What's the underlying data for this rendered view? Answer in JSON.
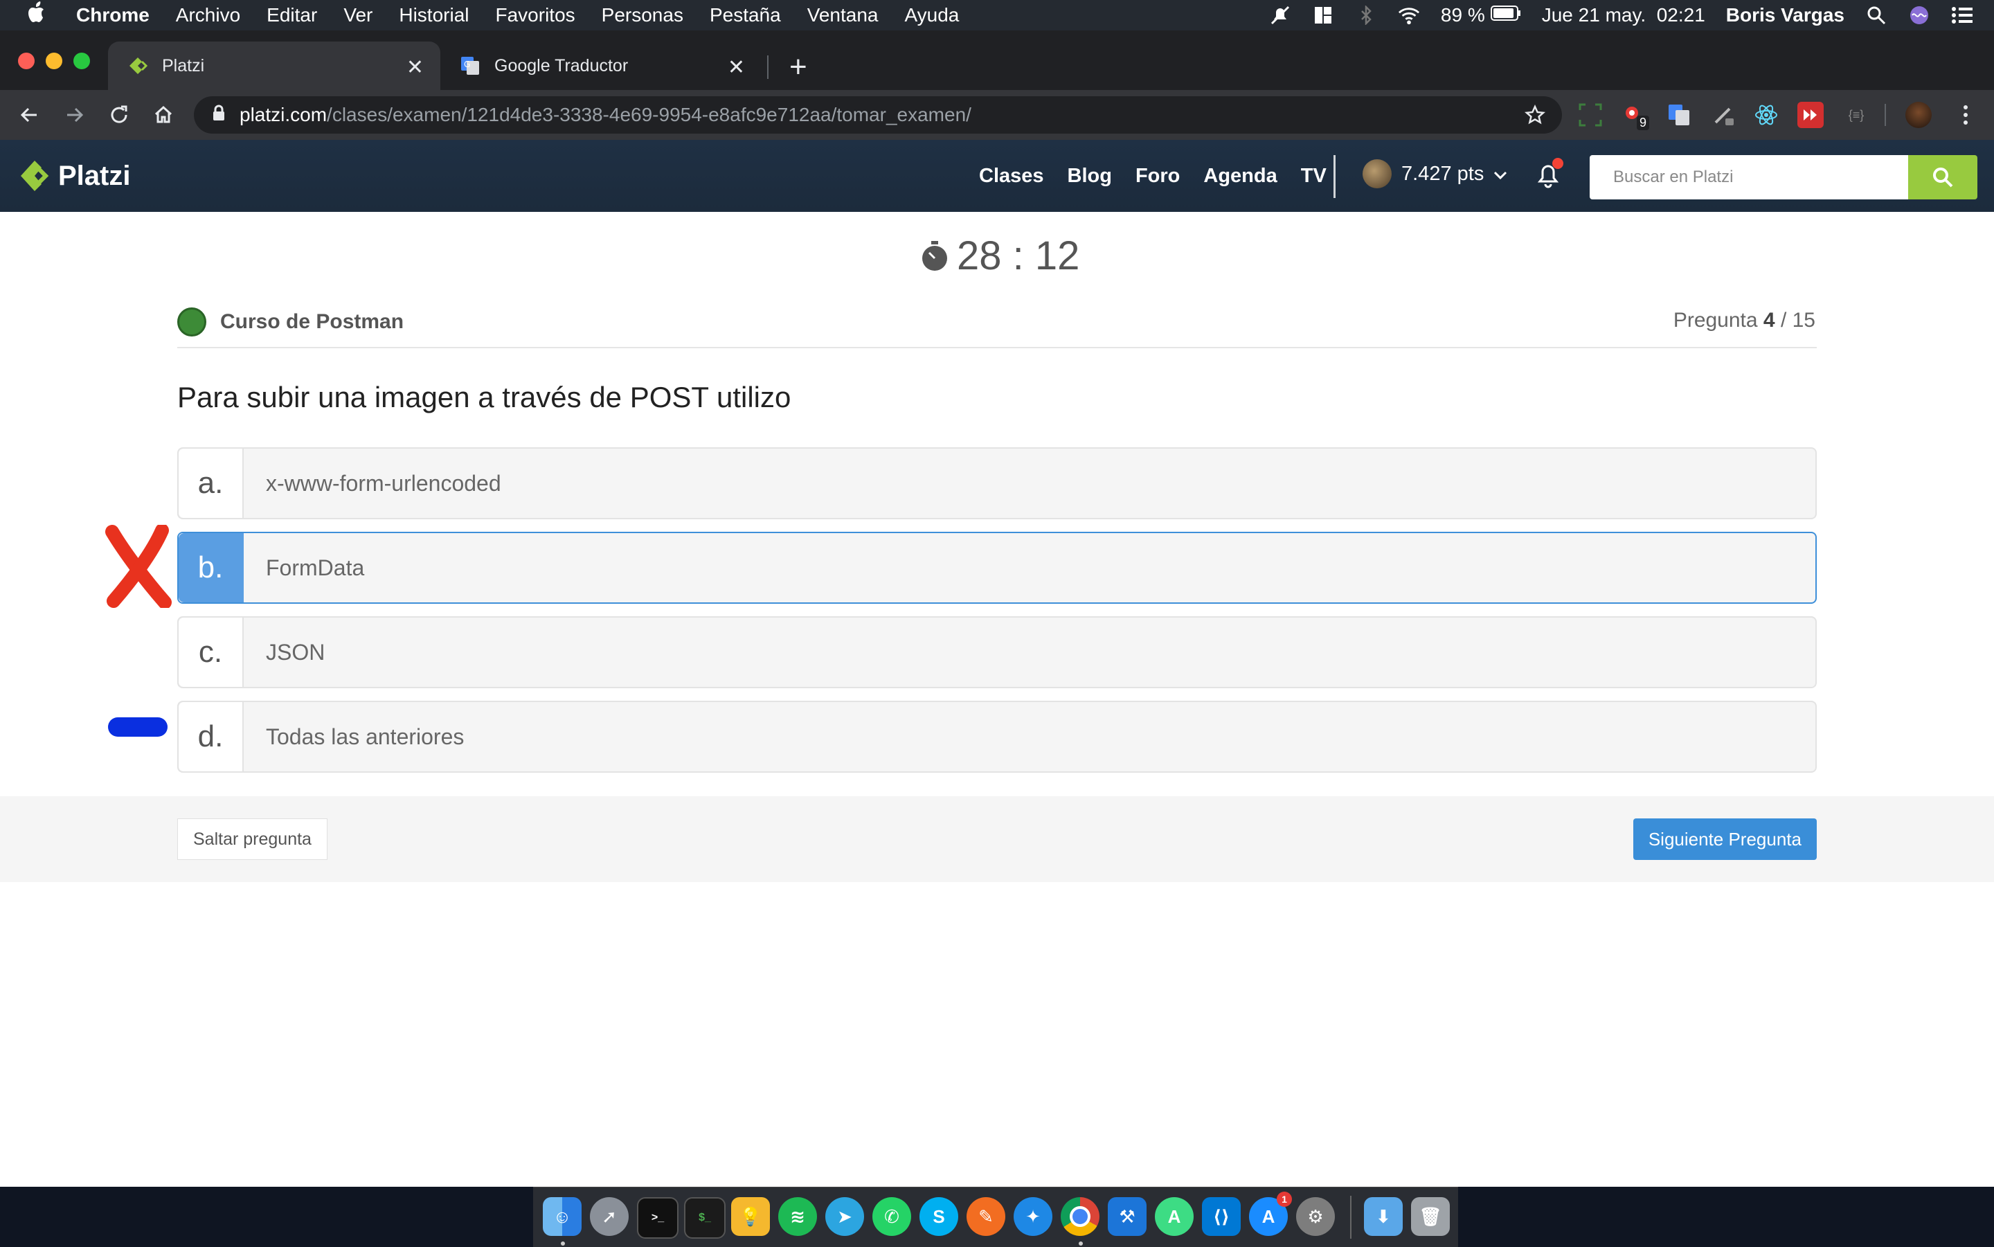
{
  "menubar": {
    "app": "Chrome",
    "menus": [
      "Archivo",
      "Editar",
      "Ver",
      "Historial",
      "Favoritos",
      "Personas",
      "Pestaña",
      "Ventana",
      "Ayuda"
    ],
    "battery": "89 %",
    "clock": "Jue 21 may.  02:21",
    "user": "Boris Vargas"
  },
  "browser": {
    "tabs": [
      {
        "title": "Platzi",
        "active": true
      },
      {
        "title": "Google Traductor",
        "active": false
      }
    ],
    "url_host": "platzi.com",
    "url_path": "/clases/examen/121d4de3-3338-4e69-9954-e8afc9e712aa/tomar_examen/",
    "extension_badge": "9"
  },
  "platzi": {
    "brand": "Platzi",
    "nav": [
      "Clases",
      "Blog",
      "Foro",
      "Agenda",
      "TV"
    ],
    "points": "7.427 pts",
    "search_placeholder": "Buscar en Platzi"
  },
  "exam": {
    "timer": "28 : 12",
    "course": "Curso de Postman",
    "question_label": "Pregunta",
    "question_current": "4",
    "question_total": "/ 15",
    "question": "Para subir una imagen a través de POST utilizo",
    "options": [
      {
        "letter": "a.",
        "text": "x-www-form-urlencoded"
      },
      {
        "letter": "b.",
        "text": "FormData",
        "selected": true
      },
      {
        "letter": "c.",
        "text": "JSON"
      },
      {
        "letter": "d.",
        "text": "Todas las anteriores"
      }
    ],
    "skip": "Saltar pregunta",
    "next": "Siguiente Pregunta"
  },
  "colors": {
    "platzi_green": "#98ca3f",
    "selected_blue": "#5a9ee2",
    "next_button": "#3a8ed8",
    "annotation_x": "#e8321e",
    "annotation_dash": "#0a2fe0"
  },
  "dock": {
    "icons": [
      "finder-icon",
      "launchpad-icon",
      "terminal-icon",
      "iterm-icon",
      "lightbulb-icon",
      "spotify-icon",
      "telegram-icon",
      "whatsapp-icon",
      "skype-icon",
      "pencil-app-icon",
      "safari-icon",
      "chrome-icon",
      "xcode-icon",
      "android-studio-icon",
      "vscode-icon",
      "app-store-icon",
      "system-preferences-icon",
      "downloads-folder-icon",
      "trash-icon"
    ],
    "app_store_badge": "1"
  }
}
